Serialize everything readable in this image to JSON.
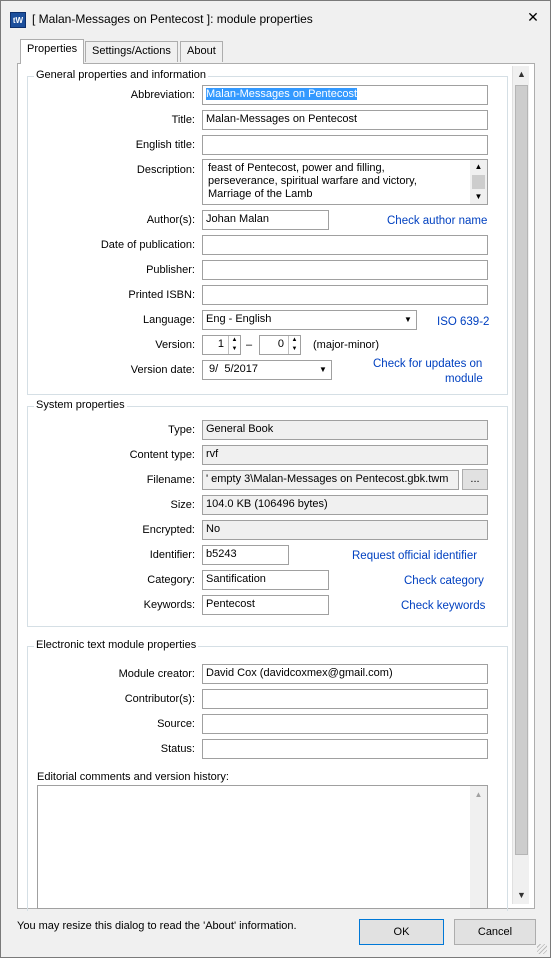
{
  "window": {
    "title": "[ Malan-Messages on Pentecost ]: module properties",
    "icon_label": "tW",
    "close_glyph": "✕"
  },
  "tabs": [
    {
      "label": "Properties"
    },
    {
      "label": "Settings/Actions"
    },
    {
      "label": "About"
    }
  ],
  "general": {
    "group_title": "General properties and information",
    "abbreviation": {
      "label": "Abbreviation:",
      "value": "Malan-Messages on Pentecost"
    },
    "title": {
      "label": "Title:",
      "value": "Malan-Messages on Pentecost"
    },
    "english_title": {
      "label": "English title:",
      "value": ""
    },
    "description": {
      "label": "Description:",
      "lines": [
        "feast of Pentecost, power and filling,",
        "perseverance, spiritual warfare and victory,",
        "Marriage of the Lamb"
      ]
    },
    "authors": {
      "label": "Author(s):",
      "value": "Johan Malan",
      "link": "Check author name"
    },
    "date_of_publication": {
      "label": "Date of publication:",
      "value": ""
    },
    "publisher": {
      "label": "Publisher:",
      "value": ""
    },
    "printed_isbn": {
      "label": "Printed ISBN:",
      "value": ""
    },
    "language": {
      "label": "Language:",
      "value": "Eng - English",
      "link": "ISO 639-2"
    },
    "version": {
      "label": "Version:",
      "major": "1",
      "minor": "0",
      "separator": "–",
      "hint": "(major-minor)"
    },
    "version_date": {
      "label": "Version date:",
      "value": " 9/  5/2017",
      "link_line1": "Check for updates on",
      "link_line2": "module"
    }
  },
  "system": {
    "group_title": "System properties",
    "type": {
      "label": "Type:",
      "value": "General Book"
    },
    "content_type": {
      "label": "Content type:",
      "value": "rvf"
    },
    "filename": {
      "label": "Filename:",
      "value": "' empty 3\\Malan-Messages on Pentecost.gbk.twm",
      "button": "..."
    },
    "size": {
      "label": "Size:",
      "value": "104.0 KB (106496 bytes)"
    },
    "encrypted": {
      "label": "Encrypted:",
      "value": "No"
    },
    "identifier": {
      "label": "Identifier:",
      "value": "b5243",
      "link": "Request official identifier"
    },
    "category": {
      "label": "Category:",
      "value": "Santification",
      "link": "Check category"
    },
    "keywords": {
      "label": "Keywords:",
      "value": "Pentecost",
      "link": "Check keywords"
    }
  },
  "etm": {
    "group_title": "Electronic text module properties",
    "module_creator": {
      "label": "Module creator:",
      "value": "David Cox (davidcoxmex@gmail.com)"
    },
    "contributors": {
      "label": "Contributor(s):",
      "value": ""
    },
    "source": {
      "label": "Source:",
      "value": ""
    },
    "status": {
      "label": "Status:",
      "value": ""
    },
    "comments_label": "Editorial comments and version history:"
  },
  "footer": {
    "hint": "You may resize this dialog to read the 'About' information.",
    "ok": "OK",
    "cancel": "Cancel"
  },
  "colors": {
    "link": "#0040c0",
    "selection": "#3399ff"
  }
}
